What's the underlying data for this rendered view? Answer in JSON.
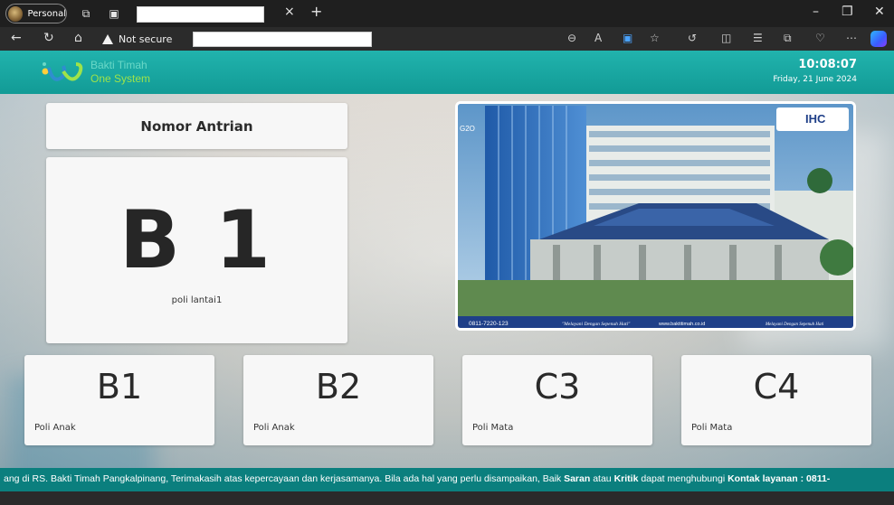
{
  "browser": {
    "profile_label": "Personal",
    "security_label": "Not secure",
    "close_tab_glyph": "×",
    "new_tab_glyph": "+",
    "icons": [
      "back-icon",
      "refresh-icon",
      "home-icon",
      "zoom-icon",
      "read-aloud-icon",
      "immersive-icon",
      "favorite-icon",
      "extensions-icon",
      "split-screen-icon",
      "favorites-bar-icon",
      "collections-icon",
      "health-icon",
      "more-icon",
      "copilot-icon"
    ]
  },
  "header": {
    "brand_line1": "Bakti Timah",
    "brand_line2": "One System",
    "time": "10:08:07",
    "date": "Friday, 21 June 2024",
    "colors": {
      "bar": "#1aa8a2",
      "brand_line1": "#6ad8c7",
      "brand_line2": "#9ee34a"
    }
  },
  "queue": {
    "title": "Nomor Antrian",
    "current_number": "B 1",
    "current_location": "poli lantai1"
  },
  "photo": {
    "logo_text": "IHC",
    "left_badge": "G2O",
    "phone": "0811-7220-123",
    "tagline": "\"Melayani Dengan Sepenuh Hati\"",
    "website": "www.baktitimah.co.id",
    "right_tagline": "Melayani Dengan Sepenuh Hati"
  },
  "counters": [
    {
      "number": "B1",
      "label": "Poli Anak"
    },
    {
      "number": "B2",
      "label": "Poli Anak"
    },
    {
      "number": "C3",
      "label": "Poli Mata"
    },
    {
      "number": "C4",
      "label": "Poli Mata"
    }
  ],
  "ticker": {
    "part1": "ang di RS. Bakti Timah Pangkalpinang, Terimakasih atas kepercayaan dan kerjasamanya. Bila ada hal yang perlu disampaikan, Baik ",
    "bold1": "Saran",
    "part2": " atau ",
    "bold2": "Kritik",
    "part3": " dapat menghubungi ",
    "bold3": "Kontak layanan : 0811-"
  }
}
